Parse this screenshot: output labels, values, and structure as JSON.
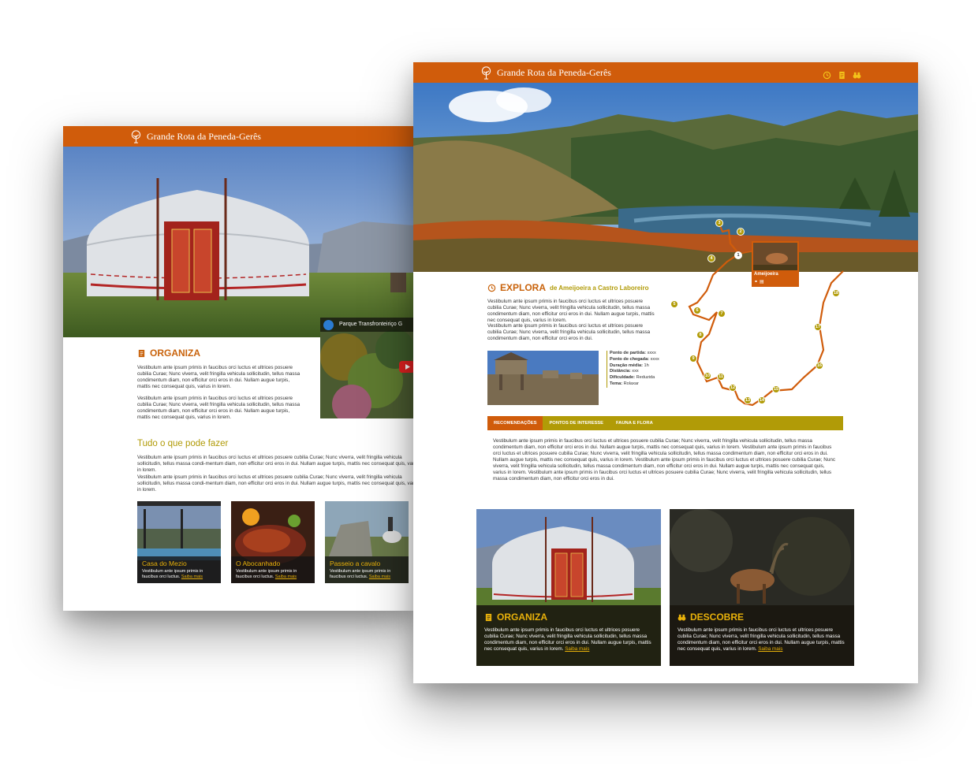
{
  "brand": {
    "name": "Grande Rota da Peneda-Gerês",
    "color": "#d05c0b",
    "accent": "#b19b07",
    "highlight": "#e8b10a"
  },
  "left_page": {
    "organiza": {
      "title": "ORGANIZA",
      "p1": "Vestibulum ante ipsum primis in faucibus orci luctus et ultrices posuere cubilia Curae; Nunc viverra, velit fringilla vehicula sollicitudin, tellus massa condimentum diam, non efficitur orci eros in dui. Nullam augue turpis, mattis nec consequat quis, varius in lorem.",
      "p2": "Vestibulum ante ipsum primis in faucibus orci luctus et ultrices posuere cubilia Curae; Nunc viverra, velit fringilla vehicula sollicitudin, tellus massa condimentum diam, non efficitur orci eros in dui. Nullam augue turpis, mattis nec consequat quis, varius in lorem."
    },
    "video": {
      "title": "Parque Transfronteiriço G"
    },
    "tudo": {
      "title": "Tudo o que pode fazer",
      "p1": "Vestibulum ante ipsum primis in faucibus orci luctus et ultrices posuere cubilia Curae; Nunc viverra, velit fringilla vehicula sollicitudin, tellus massa condi-mentum diam, non efficitur orci eros in dui. Nullam augue turpis, mattis nec consequat quis, varius in lorem.",
      "p2": "Vestibulum ante ipsum primis in faucibus orci luctus et ultrices posuere cubilia Curae; Nunc viverra, velit fringilla vehicula sollicitudin, tellus massa condi-mentum diam, non efficitur orci eros in dui. Nullam augue turpis, mattis nec consequat quis, varius in lorem."
    },
    "cards": [
      {
        "title": "Casa do Mezio",
        "desc": "Vestibulum ante ipsum primis in faucibus orci luctus.",
        "more": "Saiba mais"
      },
      {
        "title": "O Abocanhado",
        "desc": "Vestibulum ante ipsum primis in faucibus orci luctus.",
        "more": "Saiba mais"
      },
      {
        "title": "Passeio a cavalo",
        "desc": "Vestibulum ante ipsum primis in faucibus orci luctus.",
        "more": "Saiba mais"
      }
    ]
  },
  "right_page": {
    "top_icons": [
      "clock-icon",
      "document-icon",
      "binoculars-icon"
    ],
    "explora": {
      "title": "EXPLORA",
      "subtitle": "de Ameijoeira a Castro Laboreiro",
      "p1": "Vestibulum ante ipsum primis in faucibus orci luctus et ultrices posuere cubilia Curae; Nunc viverra, velit fringilla vehicula sollicitudin, tellus massa condimentum diam, non efficitur orci eros in dui. Nullam augue turpis, mattis nec consequat quis, varius in lorem.",
      "p2": "Vestibulum ante ipsum primis in faucibus orci luctus et ultrices posuere cubilia Curae; Nunc viverra, velit fringilla vehicula sollicitudin, tellus massa condimentum diam, non efficitur orci eros in dui."
    },
    "info": [
      {
        "label": "Ponto de partida:",
        "value": "xxxx"
      },
      {
        "label": "Ponto de chegada:",
        "value": "xxxx"
      },
      {
        "label": "Duração média:",
        "value": "1h"
      },
      {
        "label": "Distância:",
        "value": "xxx"
      },
      {
        "label": "Dificuldade:",
        "value": "Reduzida"
      },
      {
        "label": "Tema:",
        "value": "Rolaxar"
      }
    ],
    "map": {
      "callout_label": "Ameijoeira",
      "stages": [
        "1",
        "2",
        "3",
        "4",
        "5",
        "6",
        "7",
        "8",
        "9",
        "10",
        "11",
        "12",
        "13",
        "14",
        "15",
        "16",
        "17",
        "18"
      ]
    },
    "tabs": [
      "Recomendações",
      "Pontos de interesse",
      "Fauna e flora"
    ],
    "tab_text": "Vestibulum ante ipsum primis in faucibus orci luctus et ultrices posuere cubilia Curae; Nunc viverra, velit fringilla vehicula sollicitudin, tellus massa condimentum diam, non efficitur orci eros in dui. Nullam augue turpis, mattis nec consequat quis, varius in lorem. Vestibulum ante ipsum primis in faucibus orci luctus et ultrices posuere cubilia Curae; Nunc viverra, velit fringilla vehicula sollicitudin, tellus massa condimentum diam, non efficitur orci eros in dui. Nullam augue turpis, mattis nec consequat quis, varius in lorem. Vestibulum ante ipsum primis in faucibus orci luctus et ultrices posuere cubilia Curae; Nunc viverra, velit fringilla vehicula sollicitudin, tellus massa condimentum diam, non efficitur orci eros in dui. Nullam augue turpis, mattis nec consequat quis, varius in lorem. Vestibulum ante ipsum primis in faucibus orci luctus et ultrices posuere cubilia Curae; Nunc viverra, velit fringilla vehicula sollicitudin, tellus massa condimentum diam, non efficitur orci eros in dui.",
    "big_cards": [
      {
        "title": "ORGANIZA",
        "desc": "Vestibulum ante ipsum primis in faucibus orci luctus et ultrices posuere cubilia Curae; Nunc viverra, velit fringilla vehicula sollicitudin, tellus massa condimentum diam, non efficitur orci eros in dui. Nullam augue turpis, mattis nec consequat quis, varius in lorem.",
        "more": "Saiba mais"
      },
      {
        "title": "DESCOBRE",
        "desc": "Vestibulum ante ipsum primis in faucibus orci luctus et ultrices posuere cubilia Curae; Nunc viverra, velit fringilla vehicula sollicitudin, tellus massa condimentum diam, non efficitur orci eros in dui. Nullam augue turpis, mattis nec consequat quis, varius in lorem.",
        "more": "Saiba mais"
      }
    ]
  }
}
